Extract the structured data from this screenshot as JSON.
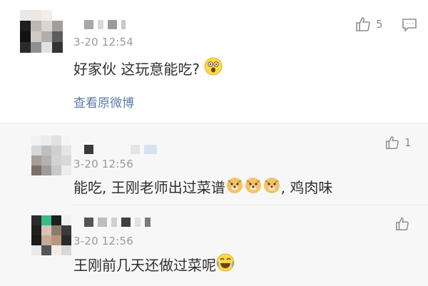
{
  "comments": [
    {
      "timestamp": "3-20 12:54",
      "text_a": "好家伙 这玩意能吃?",
      "emoji": "shocked-face-emoji",
      "view_original": "查看原微博",
      "likes": "5"
    },
    {
      "timestamp": "3-20 12:56",
      "text_a": "能吃, 王刚老师出过菜谱",
      "emoji": "doge-emoji",
      "text_b": ", 鸡肉味",
      "likes": "1"
    },
    {
      "timestamp": "3-20 12:56",
      "text_a": "王刚前几天还做过菜呢",
      "emoji": "laughing-tears-emoji",
      "likes": ""
    }
  ],
  "icons": {
    "like": "thumbs-up-icon",
    "reply": "comment-bubble-icon"
  },
  "colors": {
    "link": "#5b7ba7",
    "timestamp": "#9a9a9a",
    "text": "#2f2f2f",
    "reply_background": "#f7f7f7",
    "main_background": "#ffffff"
  }
}
